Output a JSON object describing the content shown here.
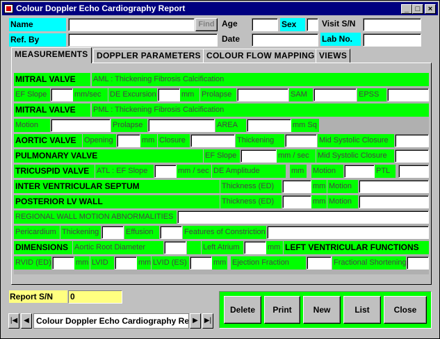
{
  "window": {
    "title": "Colour Doppler Echo Cardiography Report",
    "min": "_",
    "max": "□",
    "close": "×"
  },
  "header": {
    "name_label": "Name",
    "name_value": "",
    "find_label": "Find",
    "age_label": "Age",
    "sex_label": "Sex",
    "visit_label": "Visit S/N",
    "refby_label": "Ref. By",
    "date_label": "Date",
    "lab_label": "Lab No."
  },
  "tabs": [
    "MEASUREMENTS",
    "DOPPLER PARAMETERS",
    "COLOUR FLOW MAPPING",
    "VIEWS"
  ],
  "m": {
    "mitral1": "MITRAL VALVE",
    "aml": "AML : Thickening  Fibrosis  Calcification",
    "efslope": "EF Slope",
    "mmsec1": "mm/sec",
    "deexc": "DE Excursion",
    "mm1": "mm",
    "prolapse1": "Prolapse",
    "sam": "SAM",
    "epss": "EPSS",
    "mitral2": "MITRAL VALVE",
    "pml": "PML : Thickening  Fibrosis  Calcification",
    "motion1": "Motion",
    "prolapse2": "Prolapse",
    "area": "AREA",
    "mmsq": "mm Sq",
    "aortic": "AORTIC VALVE",
    "opening": "Opening",
    "mm2": "mm",
    "closure": "Closure",
    "thick1": "Thickening",
    "midsys1": "Mid Systolic Closure",
    "pulm": "PULMONARY VALVE",
    "efslope2": "EF Slope",
    "mmsec2": "mm / sec",
    "midsys2": "Mid Systolic Closure",
    "tricus": "TRICUSPID VALVE",
    "atl": "ATL : EF Slope",
    "mmsec3": "mm / sec",
    "deamp": "DE Amplitude",
    "mm3": "mm",
    "motion2": "Motion",
    "ptl": "PTL",
    "ivs": "INTER VENTRICULAR SEPTUM",
    "thicked1": "Thickness (ED)",
    "mm4": "mm",
    "motion3": "Motion",
    "plv": "POSTERIOR LV WALL",
    "thicked2": "Thickness (ED)",
    "mm5": "mm",
    "motion4": "Motion",
    "rwma": "REGIONAL WALL MOTION ABNORMALITIES",
    "peri": "Pericardium",
    "thick2": "Thickening",
    "effusion": "Effusion",
    "constr": "Features of Constriction",
    "dims": "DIMENSIONS",
    "aortroot": "Aortic Root Diameter",
    "leftatr": "Left Atrium",
    "mm6": "mm",
    "lvf": "LEFT VENTRICULAR FUNCTIONS",
    "rvid": "RVID (ED)",
    "mm7": "mm",
    "lvid": "LVID",
    "mm8": "mm",
    "lvides": "LVID (ES)",
    "mm9": "mm",
    "ef": "Ejection Fraction",
    "fs": "Fractional Shortening"
  },
  "report": {
    "label": "Report S/N",
    "value": "0"
  },
  "actions": [
    "Delete",
    "Print",
    "New",
    "List",
    "Close"
  ],
  "nav": {
    "record": "Colour Doppler Echo Cardiography Report",
    "first": "|◀",
    "prev": "◀",
    "next": "▶",
    "last": "▶|"
  }
}
